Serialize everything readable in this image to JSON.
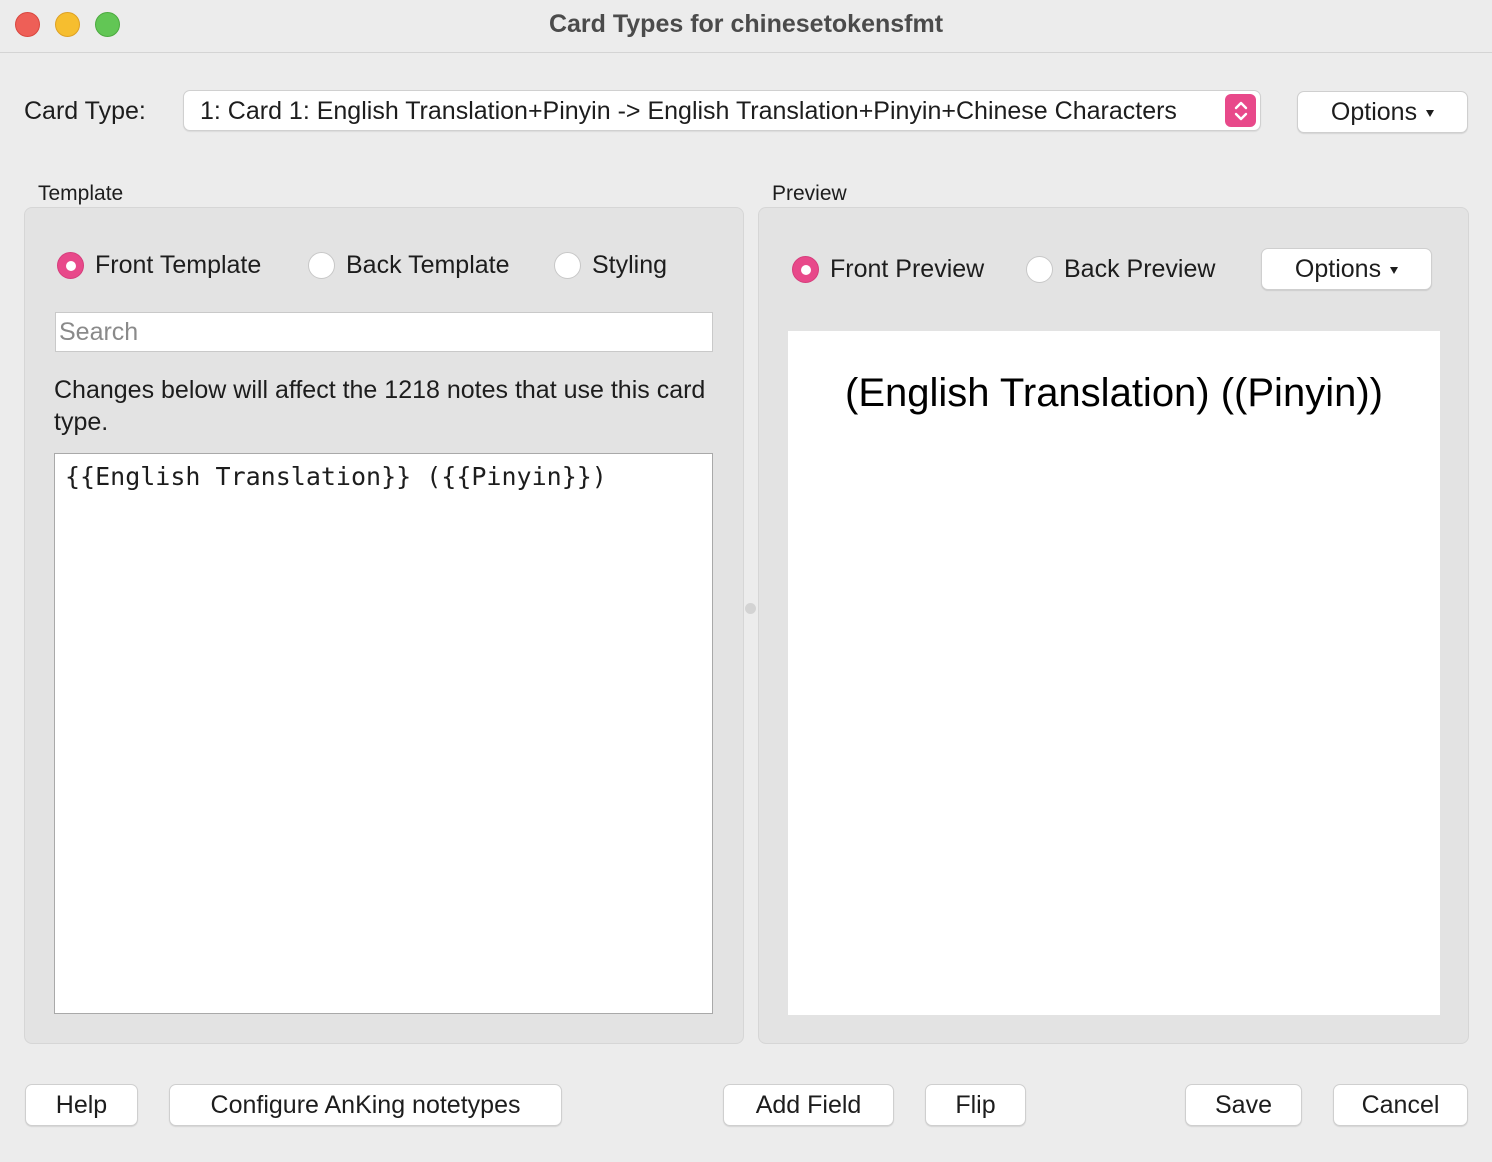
{
  "window": {
    "title": "Card Types for chinesetokensfmt"
  },
  "card_type": {
    "label": "Card Type:",
    "selected": "1: Card 1: English Translation+Pinyin -> English Translation+Pinyin+Chinese Characters",
    "options_button": "Options"
  },
  "template": {
    "section_label": "Template",
    "radios": [
      {
        "label": "Front Template",
        "checked": true
      },
      {
        "label": "Back Template",
        "checked": false
      },
      {
        "label": "Styling",
        "checked": false
      }
    ],
    "search_placeholder": "Search",
    "info": "Changes below will affect the 1218 notes that use this card type.",
    "editor_content": "{{English Translation}} ({{Pinyin}})"
  },
  "preview": {
    "section_label": "Preview",
    "radios": [
      {
        "label": "Front Preview",
        "checked": true
      },
      {
        "label": "Back Preview",
        "checked": false
      }
    ],
    "options_button": "Options",
    "rendered_text": "(English Translation) ((Pinyin))"
  },
  "footer": {
    "help": "Help",
    "configure": "Configure AnKing notetypes",
    "add_field": "Add Field",
    "flip": "Flip",
    "save": "Save",
    "cancel": "Cancel"
  },
  "colors": {
    "accent": "#e8498a",
    "window_bg": "#ececec",
    "panel_bg": "#e3e3e3"
  }
}
